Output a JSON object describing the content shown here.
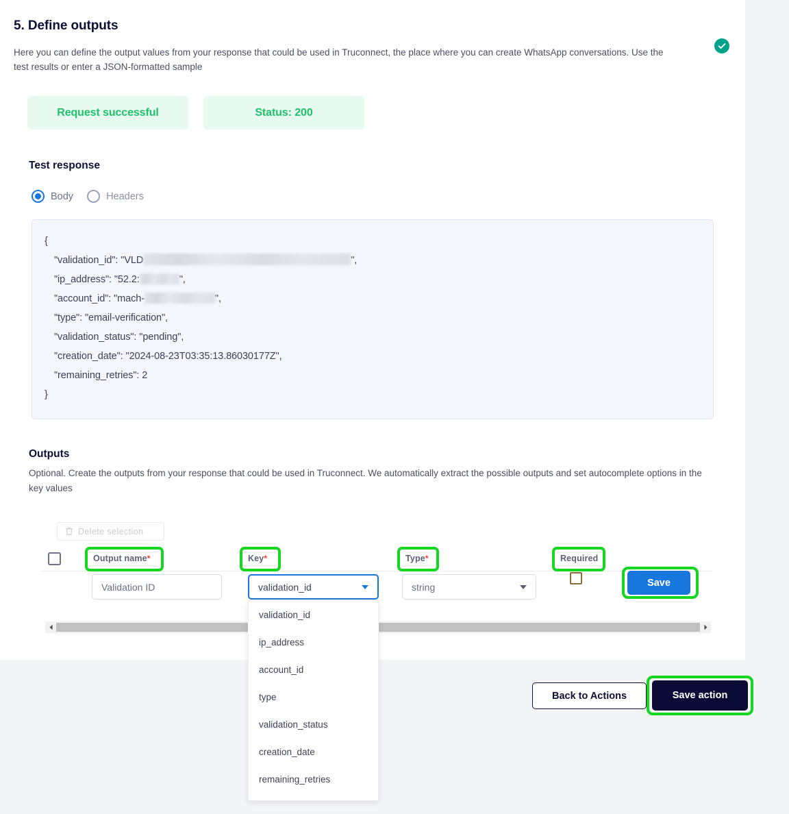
{
  "header": {
    "title": "5. Define outputs",
    "description": "Here you can define the output values from your response that could be used in Truconnect, the place where you can create WhatsApp conversations. Use the test results or enter a JSON-formatted sample",
    "status_icon": "check-circle-icon",
    "status_icon_color": "#00a389"
  },
  "status_pills": {
    "request": "Request successful",
    "status": "Status: 200",
    "background": "#e6faef",
    "text_color": "#21c06b"
  },
  "test_response": {
    "heading": "Test response",
    "tabs": [
      {
        "label": "Body",
        "selected": true
      },
      {
        "label": "Headers",
        "selected": false
      }
    ],
    "json_lines": [
      {
        "text": "{",
        "indent": false
      },
      {
        "prefix": "\"validation_id\": \"VLD",
        "redacted": "r-validation",
        "suffix": "\",",
        "indent": true
      },
      {
        "prefix": "\"ip_address\": \"52.2:",
        "redacted": "r-ip",
        "suffix": "\",",
        "indent": true
      },
      {
        "prefix": "\"account_id\": \"mach-",
        "redacted": "r-account",
        "suffix": "\",",
        "indent": true
      },
      {
        "text": "\"type\": \"email-verification\",",
        "indent": true
      },
      {
        "text": "\"validation_status\": \"pending\",",
        "indent": true
      },
      {
        "text": "\"creation_date\": \"2024-08-23T03:35:13.86030177Z\",",
        "indent": true
      },
      {
        "text": "\"remaining_retries\": 2",
        "indent": true
      },
      {
        "text": "}",
        "indent": false
      }
    ]
  },
  "outputs": {
    "heading": "Outputs",
    "description": "Optional. Create the outputs from your response that could be used in Truconnect. We automatically extract the possible outputs and set autocomplete options in the key values",
    "delete_selection_label": "Delete selection",
    "delete_icon": "trash-icon",
    "columns": [
      {
        "label": "Output name",
        "required_marker": "*"
      },
      {
        "label": "Key",
        "required_marker": "*"
      },
      {
        "label": "Type",
        "required_marker": "*"
      },
      {
        "label": "Required",
        "required_marker": ""
      }
    ],
    "row": {
      "output_name_value": "Validation ID",
      "key_value": "validation_id",
      "type_value": "string",
      "required_checked": false,
      "save_label": "Save"
    },
    "key_dropdown_options": [
      "validation_id",
      "ip_address",
      "account_id",
      "type",
      "validation_status",
      "creation_date",
      "remaining_retries"
    ]
  },
  "actions": {
    "back_label": "Back to Actions",
    "save_action_label": "Save action"
  },
  "annotations": {
    "highlight_color": "#16d622",
    "highlighted": [
      "Output name",
      "Key",
      "Type",
      "Required",
      "Save",
      "Save action"
    ]
  }
}
